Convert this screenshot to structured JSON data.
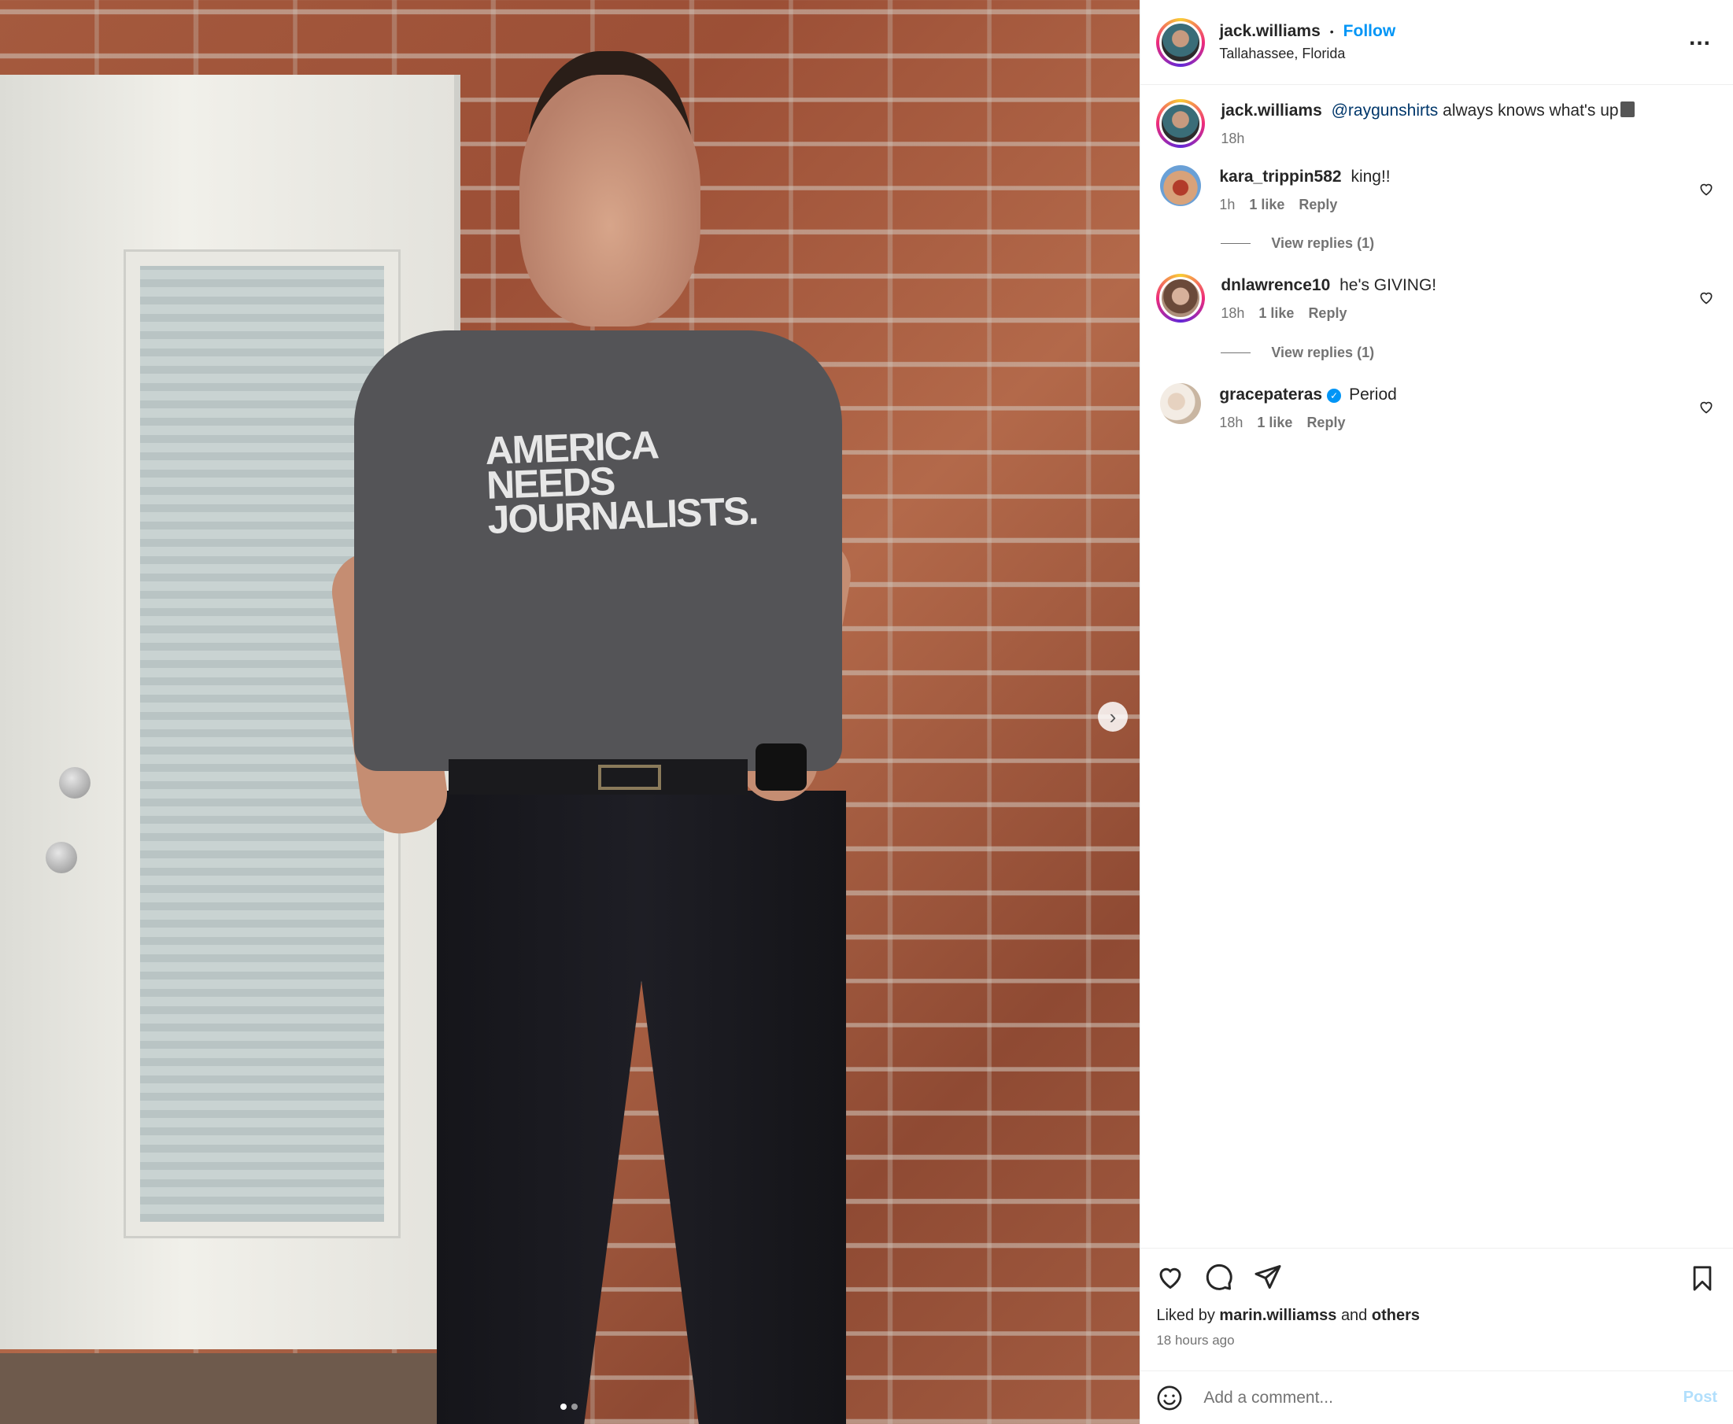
{
  "post": {
    "author": "jack.williams",
    "follow_label": "Follow",
    "location": "Tallahassee, Florida",
    "more_label": "...",
    "shirt_text": [
      "AMERICA",
      "NEEDS",
      "JOURNALISTS."
    ],
    "carousel": {
      "index": 1,
      "total": 2
    }
  },
  "caption": {
    "user": "jack.williams",
    "mention": "@raygunshirts",
    "text": "always knows what's up",
    "time": "18h"
  },
  "comments": [
    {
      "user": "kara_trippin582",
      "text": "king!!",
      "time": "1h",
      "likes": "1 like",
      "reply": "Reply",
      "view_replies": "View replies (1)"
    },
    {
      "user": "dnlawrence10",
      "text": "he's GIVING!",
      "time": "18h",
      "likes": "1 like",
      "reply": "Reply",
      "view_replies": "View replies (1)"
    },
    {
      "user": "gracepateras",
      "verified": true,
      "text": "Period",
      "time": "18h",
      "likes": "1 like",
      "reply": "Reply"
    }
  ],
  "footer": {
    "liked_prefix": "Liked by",
    "liked_user": "marin.williamss",
    "liked_and": "and",
    "liked_others": "others",
    "time_ago": "18 hours ago",
    "comment_placeholder": "Add a comment...",
    "post_label": "Post"
  },
  "colors": {
    "accent": "#0095f6",
    "text": "#262626",
    "muted": "#737373",
    "post_disabled": "#b2dffc"
  }
}
